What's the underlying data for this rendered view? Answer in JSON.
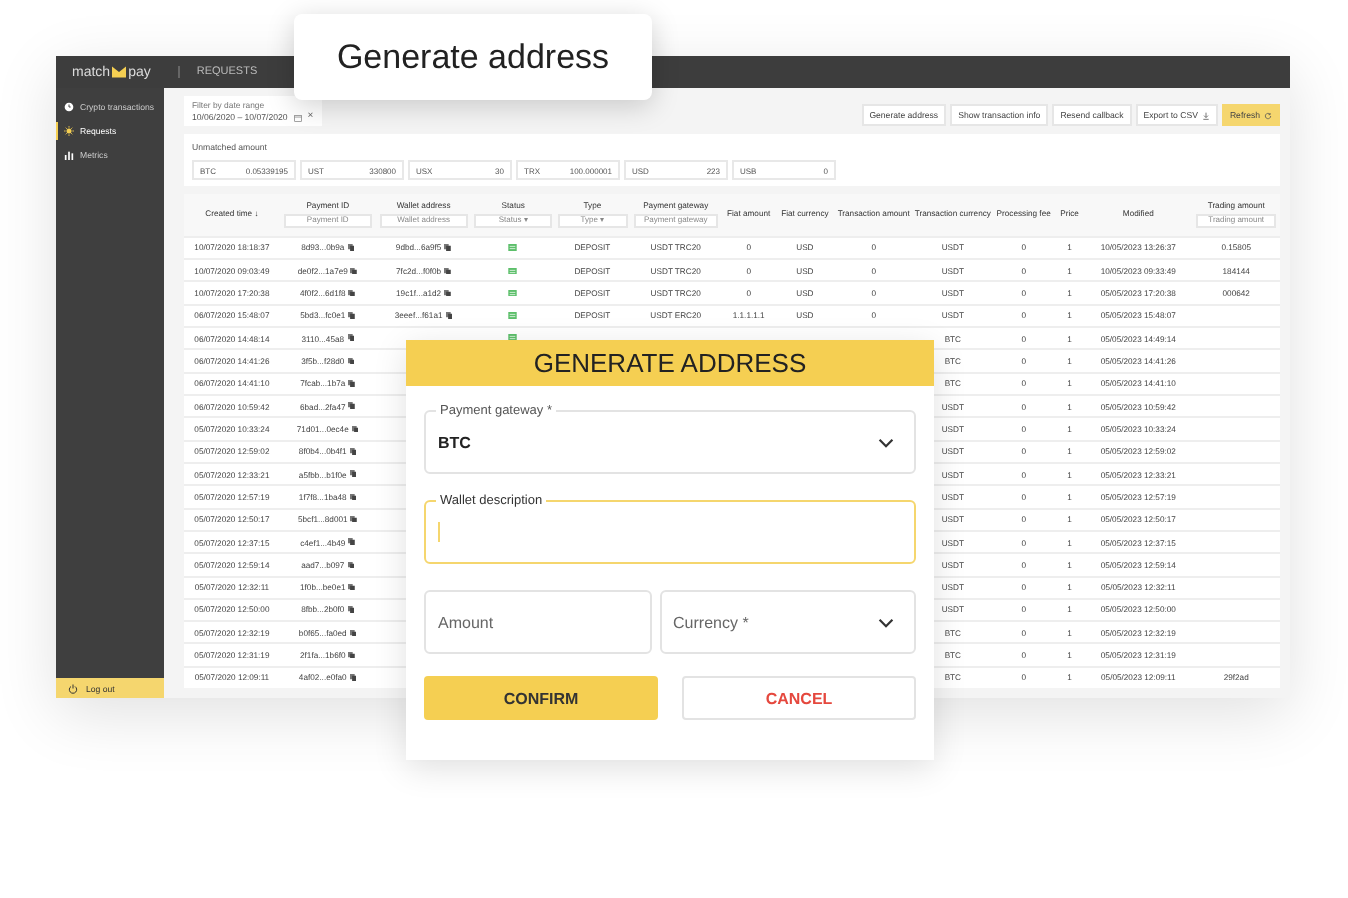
{
  "callout": {
    "title": "Generate address"
  },
  "app": {
    "logo": {
      "left": "match",
      "right": "pay"
    },
    "header_title": "REQUESTS",
    "sidebar": {
      "items": [
        {
          "label": "Crypto transactions",
          "selected": false
        },
        {
          "label": "Requests",
          "selected": true
        },
        {
          "label": "Metrics",
          "selected": false
        }
      ],
      "logout": "Log out"
    },
    "date_filter": {
      "label": "Filter by date range",
      "value": "10/06/2020 – 10/07/2020",
      "clear": "×"
    },
    "toolbar": [
      {
        "label": "Generate address",
        "kind": "plain"
      },
      {
        "label": "Show transaction info",
        "kind": "plain"
      },
      {
        "label": "Resend callback",
        "kind": "plain"
      },
      {
        "label": "Export to CSV",
        "kind": "download"
      },
      {
        "label": "Refresh",
        "kind": "primary"
      }
    ],
    "unmatched": {
      "title": "Unmatched amount",
      "balances": [
        {
          "currency": "BTC",
          "amount": "0.05339195"
        },
        {
          "currency": "UST",
          "amount": "330800"
        },
        {
          "currency": "USX",
          "amount": "30"
        },
        {
          "currency": "TRX",
          "amount": "100.000001"
        },
        {
          "currency": "USD",
          "amount": "223"
        },
        {
          "currency": "USB",
          "amount": "0"
        }
      ]
    },
    "table": {
      "columns": [
        {
          "label": "Created time ↓"
        },
        {
          "label": "Payment ID",
          "filter": "Payment ID"
        },
        {
          "label": "Wallet address",
          "filter": "Wallet address"
        },
        {
          "label": "Status",
          "filter": "Status ▾"
        },
        {
          "label": "Type",
          "filter": "Type ▾"
        },
        {
          "label": "Payment gateway",
          "filter": "Payment gateway"
        },
        {
          "label": "Fiat amount"
        },
        {
          "label": "Fiat currency"
        },
        {
          "label": "Transaction amount"
        },
        {
          "label": "Transaction currency"
        },
        {
          "label": "Processing fee"
        },
        {
          "label": "Price"
        },
        {
          "label": "Modified"
        },
        {
          "label": "Trading amount",
          "filter": "Trading amount"
        }
      ],
      "rows": [
        {
          "created": "10/07/2020 18:18:37",
          "payment_id": "8d93...0b9a",
          "wallet": "9dbd...6a9f5",
          "status_ok": true,
          "type": "DEPOSIT",
          "gateway": "USDT TRC20",
          "fiat_amount": "0",
          "fiat_currency": "USD",
          "tx_amount": "0",
          "tx_currency": "USDT",
          "fee": "0",
          "price": "1",
          "modified": "10/05/2023 13:26:37",
          "trading": "0.15805"
        },
        {
          "created": "10/07/2020 09:03:49",
          "payment_id": "de0f2...1a7e9",
          "wallet": "7fc2d...f0f0b",
          "status_ok": true,
          "type": "DEPOSIT",
          "gateway": "USDT TRC20",
          "fiat_amount": "0",
          "fiat_currency": "USD",
          "tx_amount": "0",
          "tx_currency": "USDT",
          "fee": "0",
          "price": "1",
          "modified": "10/05/2023 09:33:49",
          "trading": "184144"
        },
        {
          "created": "10/07/2020 17:20:38",
          "payment_id": "4f0f2...6d1f8",
          "wallet": "19c1f...a1d2",
          "status_ok": true,
          "type": "DEPOSIT",
          "gateway": "USDT TRC20",
          "fiat_amount": "0",
          "fiat_currency": "USD",
          "tx_amount": "0",
          "tx_currency": "USDT",
          "fee": "0",
          "price": "1",
          "modified": "05/05/2023 17:20:38",
          "trading": "000642"
        },
        {
          "created": "06/07/2020 15:48:07",
          "payment_id": "5bd3...fc0e1",
          "wallet": "3eeef...f61a1",
          "status_ok": true,
          "type": "DEPOSIT",
          "gateway": "USDT ERC20",
          "fiat_amount": "1.1.1.1.1",
          "fiat_currency": "USD",
          "tx_amount": "0",
          "tx_currency": "USDT",
          "fee": "0",
          "price": "1",
          "modified": "05/05/2023 15:48:07"
        },
        {
          "created": "06/07/2020 14:48:14",
          "payment_id": "3110...45a8",
          "status_ok": true,
          "tx_currency": "BTC",
          "fee": "0",
          "price": "1",
          "modified": "05/05/2023 14:49:14"
        },
        {
          "created": "06/07/2020 14:41:26",
          "payment_id": "3f5b...f28d0",
          "tx_currency": "BTC",
          "fee": "0",
          "price": "1",
          "modified": "05/05/2023 14:41:26"
        },
        {
          "created": "06/07/2020 14:41:10",
          "payment_id": "7fcab...1b7a",
          "tx_currency": "BTC",
          "fee": "0",
          "price": "1",
          "modified": "05/05/2023 14:41:10"
        },
        {
          "created": "06/07/2020 10:59:42",
          "payment_id": "6bad...2fa47",
          "tx_currency": "USDT",
          "fee": "0",
          "price": "1",
          "modified": "05/05/2023 10:59:42"
        },
        {
          "created": "05/07/2020 10:33:24",
          "payment_id": "71d01...0ec4e",
          "tx_currency": "USDT",
          "fee": "0",
          "price": "1",
          "modified": "05/05/2023 10:33:24"
        },
        {
          "created": "05/07/2020 12:59:02",
          "payment_id": "8f0b4...0b4f1",
          "tx_currency": "USDT",
          "fee": "0",
          "price": "1",
          "modified": "05/05/2023 12:59:02"
        },
        {
          "created": "05/07/2020 12:33:21",
          "payment_id": "a5fbb...b1f0e",
          "tx_currency": "USDT",
          "fee": "0",
          "price": "1",
          "modified": "05/05/2023 12:33:21"
        },
        {
          "created": "05/07/2020 12:57:19",
          "payment_id": "1f7f8...1ba48",
          "tx_currency": "USDT",
          "fee": "0",
          "price": "1",
          "modified": "05/05/2023 12:57:19"
        },
        {
          "created": "05/07/2020 12:50:17",
          "payment_id": "5bcf1...8d001",
          "tx_currency": "USDT",
          "fee": "0",
          "price": "1",
          "modified": "05/05/2023 12:50:17"
        },
        {
          "created": "05/07/2020 12:37:15",
          "payment_id": "c4ef1...4b49",
          "tx_currency": "USDT",
          "fee": "0",
          "price": "1",
          "modified": "05/05/2023 12:37:15"
        },
        {
          "created": "05/07/2020 12:59:14",
          "payment_id": "aad7...b097",
          "tx_currency": "USDT",
          "fee": "0",
          "price": "1",
          "modified": "05/05/2023 12:59:14"
        },
        {
          "created": "05/07/2020 12:32:11",
          "payment_id": "1f0b...be0e1",
          "tx_currency": "USDT",
          "fee": "0",
          "price": "1",
          "modified": "05/05/2023 12:32:11"
        },
        {
          "created": "05/07/2020 12:50:00",
          "payment_id": "8fbb...2b0f0",
          "tx_currency": "USDT",
          "fee": "0",
          "price": "1",
          "modified": "05/05/2023 12:50:00"
        },
        {
          "created": "05/07/2020 12:32:19",
          "payment_id": "b0f65...fa0ed",
          "tx_currency": "BTC",
          "fee": "0",
          "price": "1",
          "modified": "05/05/2023 12:32:19"
        },
        {
          "created": "05/07/2020 12:31:19",
          "payment_id": "2f1fa...1b6f0",
          "tx_currency": "BTC",
          "fee": "0",
          "price": "1",
          "modified": "05/05/2023 12:31:19"
        },
        {
          "created": "05/07/2020 12:09:11",
          "payment_id": "4af02...e0fa0",
          "tx_currency": "BTC",
          "fee": "0",
          "price": "1",
          "modified": "05/05/2023 12:09:11",
          "trading": "29f2ad"
        }
      ]
    }
  },
  "modal": {
    "title": "GENERATE ADDRESS",
    "fields": [
      {
        "kind": "select",
        "label": "Payment gateway *",
        "value": "BTC",
        "focused": false
      },
      {
        "kind": "text",
        "label": "Wallet description",
        "focused": true
      },
      {
        "kind": "text",
        "placeholder": "Amount",
        "focused": false
      },
      {
        "kind": "select",
        "placeholder": "Currency *",
        "focused": false
      }
    ],
    "buttons": [
      {
        "label": "CONFIRM",
        "kind": "primary"
      },
      {
        "label": "CANCEL",
        "kind": "danger"
      }
    ]
  }
}
